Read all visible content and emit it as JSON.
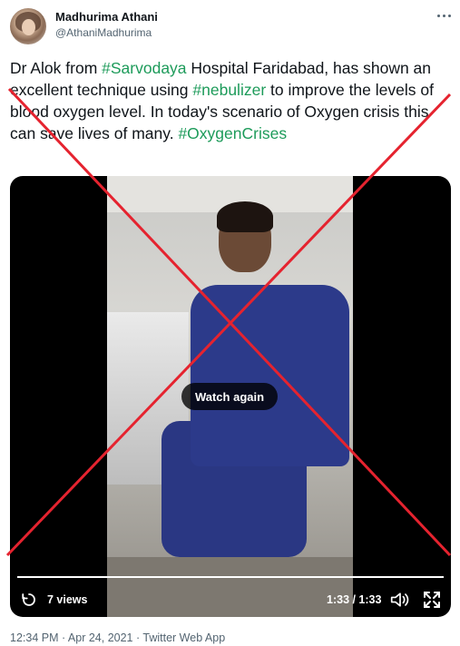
{
  "author": {
    "name": "Madhurima Athani",
    "handle": "@AthaniMadhurima",
    "avatar_icon": "profile-photo"
  },
  "tweet": {
    "t1": "Dr Alok from ",
    "tag1": "#Sarvodaya",
    "t2": " Hospital Faridabad, has shown an excellent technique using ",
    "tag2": "#nebulizer",
    "t3": " to improve the levels of blood oxygen level. In today's scenario of Oxygen crisis this can save lives of many. ",
    "tag3": "#OxygenCrises",
    "hashtag_color": "#1d9b5a"
  },
  "video": {
    "overlay_label": "Watch again",
    "views": "7 views",
    "time": "1:33 / 1:33",
    "progress_fraction": 1.0
  },
  "footer": {
    "meta": "12:34 PM · Apr 24, 2021 · Twitter Web App"
  },
  "overlay": {
    "cross_color": "#e5232f"
  }
}
